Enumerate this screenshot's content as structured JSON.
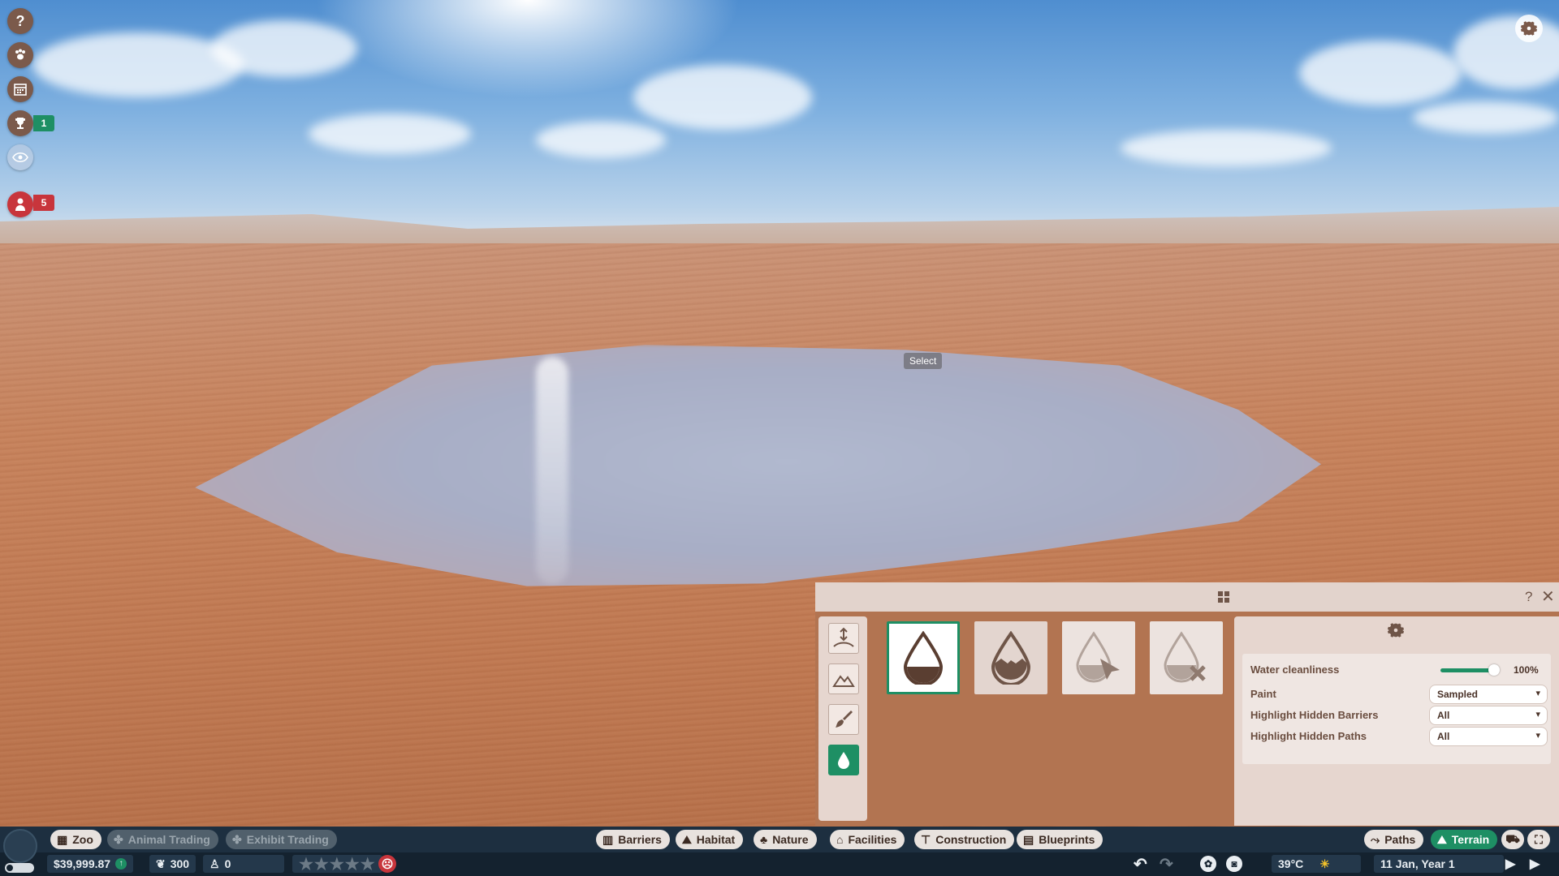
{
  "scene": {
    "tooltip": "Select"
  },
  "left_toolbar": {
    "items": [
      {
        "name": "help",
        "icon": "question-icon"
      },
      {
        "name": "animals",
        "icon": "paw-icon"
      },
      {
        "name": "calendar",
        "icon": "calendar-icon"
      },
      {
        "name": "objectives",
        "icon": "trophy-icon",
        "badge": "1",
        "badge_color": "#1e8f64"
      },
      {
        "name": "visibility",
        "icon": "eye-icon"
      },
      {
        "name": "staff",
        "icon": "person-icon",
        "badge": "5",
        "badge_color": "#c8353c"
      }
    ]
  },
  "terrain_panel": {
    "header_icon": "grid-icon",
    "help_label": "?",
    "close_label": "✕",
    "tools": [
      "terrain-height-icon",
      "mountain-icon",
      "paintbrush-icon",
      "water-drop-icon"
    ],
    "active_tool": "water",
    "options": [
      "water-fill-icon",
      "water-level-icon",
      "water-select-icon",
      "water-delete-icon"
    ],
    "settings": {
      "water_cleanliness_label": "Water cleanliness",
      "water_cleanliness_value": "100%",
      "water_cleanliness_fraction": 1.0,
      "paint_label": "Paint",
      "paint_value": "Sampled",
      "barriers_label": "Highlight Hidden Barriers",
      "barriers_value": "All",
      "paths_label": "Highlight Hidden Paths",
      "paths_value": "All"
    }
  },
  "bottom_bar": {
    "left_tabs": [
      {
        "label": "Zoo",
        "active": true
      },
      {
        "label": "Animal Trading",
        "active": false
      },
      {
        "label": "Exhibit Trading",
        "active": false
      }
    ],
    "center_tabs": [
      "Barriers",
      "Habitat",
      "Nature",
      "Facilities",
      "Construction",
      "Blueprints"
    ],
    "right_tabs": [
      {
        "label": "Paths",
        "active": false
      },
      {
        "label": "Terrain",
        "active": true
      }
    ],
    "money": "$39,999.87",
    "conservation": "300",
    "guests": "0",
    "temperature": "39°C",
    "date": "11 Jan, Year 1",
    "rating_stars": 0
  },
  "colors": {
    "accent": "#1e8f64",
    "alert": "#c8353c",
    "panel": "#e6d6cf",
    "bar": "#1d2f40"
  }
}
